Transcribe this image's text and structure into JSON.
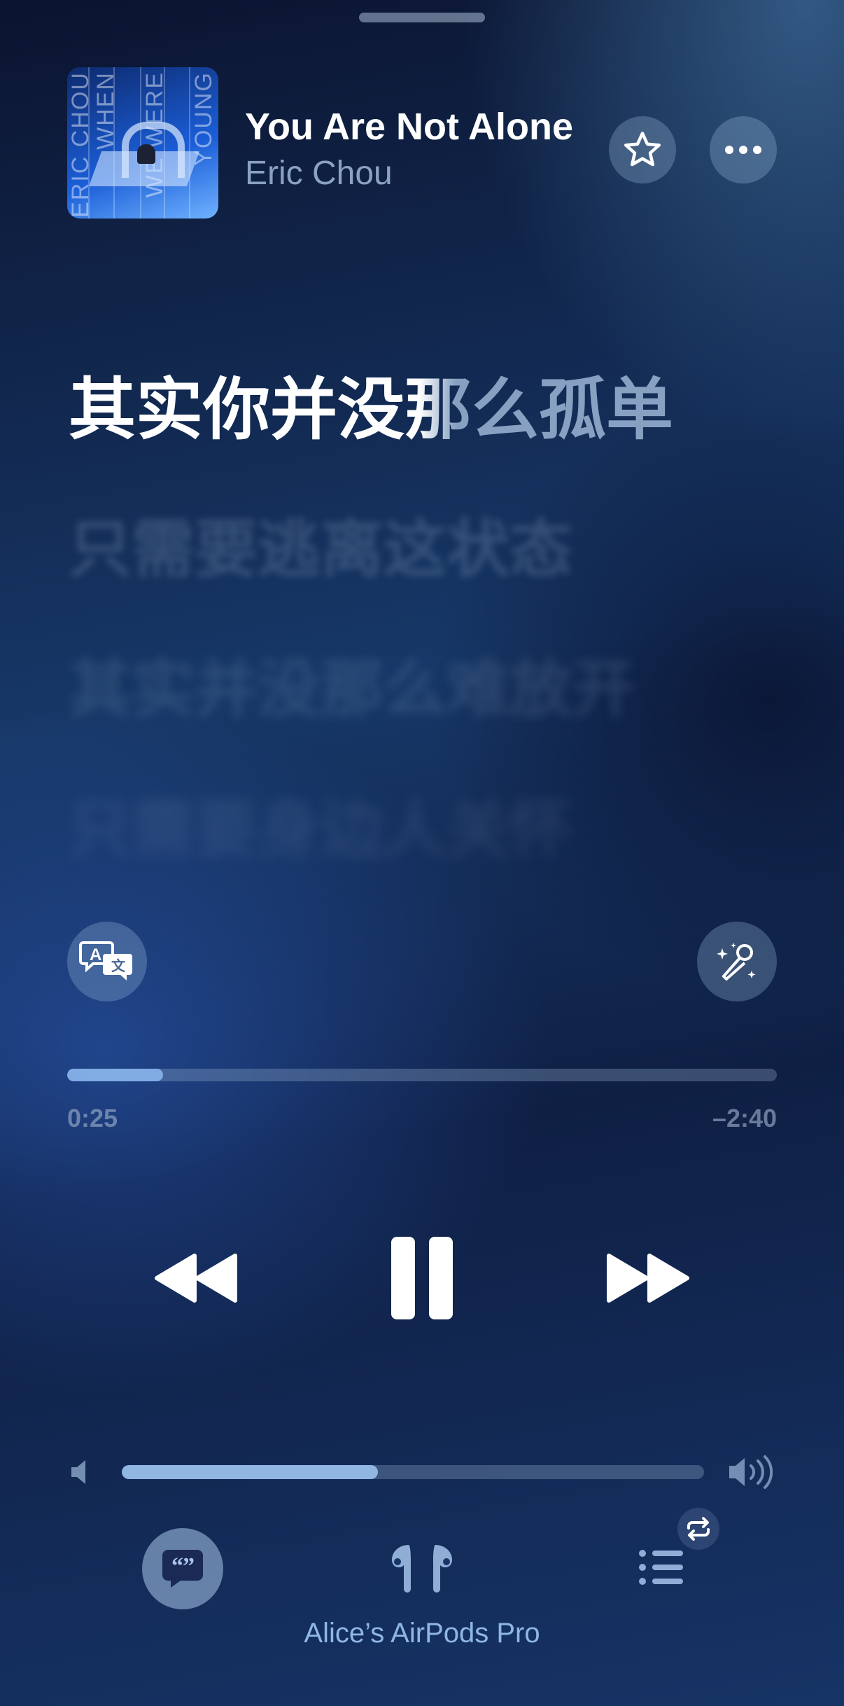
{
  "now_playing": {
    "title": "You Are Not Alone",
    "artist": "Eric Chou",
    "artwork": {
      "text_lines": [
        "ERIC CHOU",
        "WHEN",
        "WE WERE",
        "YOUNG"
      ]
    }
  },
  "lyrics": [
    "其实你并没那么孤单",
    "只需要逃离这状态",
    "其实并没那么难放开",
    "只需要身边人关怀"
  ],
  "lyrics_active_index": 0,
  "playback": {
    "elapsed": "0:25",
    "remaining": "–2:40",
    "progress_fraction": 0.135
  },
  "volume": {
    "level_fraction": 0.44
  },
  "output_device": "Alice’s AirPods Pro",
  "icons": {
    "favorite": "star-icon",
    "more": "ellipsis-icon",
    "translate": "translate-icon",
    "sing": "microphone-sparkle-icon",
    "rewind": "rewind-icon",
    "pause": "pause-icon",
    "forward": "fast-forward-icon",
    "lyrics": "quote-bubble-icon",
    "airplay": "airpods-pro-icon",
    "queue": "list-icon",
    "repeat": "repeat-icon"
  },
  "colors": {
    "accent": "#8cb9f0",
    "text_primary": "#ffffff",
    "text_secondary": "#aac3e1"
  }
}
